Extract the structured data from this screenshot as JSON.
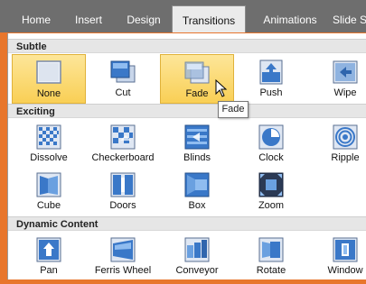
{
  "ribbon": {
    "tabs": [
      {
        "label": "Home"
      },
      {
        "label": "Insert"
      },
      {
        "label": "Design"
      },
      {
        "label": "Transitions",
        "active": true
      },
      {
        "label": "Animations"
      },
      {
        "label": "Slide S"
      }
    ]
  },
  "gallery": {
    "sections": [
      {
        "title": "Subtle",
        "items": [
          {
            "label": "None",
            "icon": "none-icon",
            "selected": true
          },
          {
            "label": "Cut",
            "icon": "cut-icon"
          },
          {
            "label": "Fade",
            "icon": "fade-icon",
            "selected": true
          },
          {
            "label": "Push",
            "icon": "push-icon"
          },
          {
            "label": "Wipe",
            "icon": "wipe-icon"
          }
        ]
      },
      {
        "title": "Exciting",
        "items": [
          {
            "label": "Dissolve",
            "icon": "dissolve-icon"
          },
          {
            "label": "Checkerboard",
            "icon": "checkerboard-icon"
          },
          {
            "label": "Blinds",
            "icon": "blinds-icon"
          },
          {
            "label": "Clock",
            "icon": "clock-icon"
          },
          {
            "label": "Ripple",
            "icon": "ripple-icon"
          },
          {
            "label": "Cube",
            "icon": "cube-icon"
          },
          {
            "label": "Doors",
            "icon": "doors-icon"
          },
          {
            "label": "Box",
            "icon": "box-icon"
          },
          {
            "label": "Zoom",
            "icon": "zoom-icon"
          }
        ]
      },
      {
        "title": "Dynamic Content",
        "items": [
          {
            "label": "Pan",
            "icon": "pan-icon"
          },
          {
            "label": "Ferris Wheel",
            "icon": "ferris-wheel-icon"
          },
          {
            "label": "Conveyor",
            "icon": "conveyor-icon"
          },
          {
            "label": "Rotate",
            "icon": "rotate-icon"
          },
          {
            "label": "Window",
            "icon": "window-icon"
          }
        ]
      }
    ]
  },
  "tooltip": {
    "text": "Fade"
  },
  "colors": {
    "accent_orange": "#e8762c",
    "ribbon_gray": "#6e6e6e",
    "selected_fill": "#f9cf55",
    "icon_blue": "#3a78c8"
  }
}
